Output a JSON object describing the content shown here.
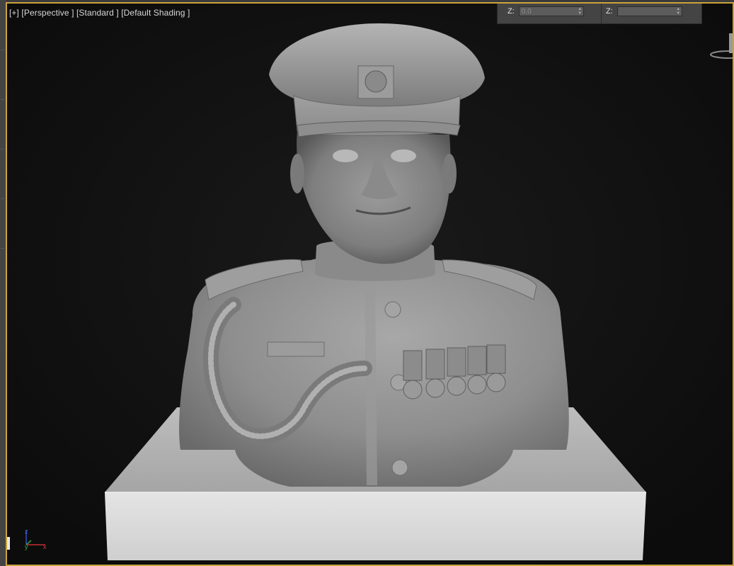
{
  "viewport": {
    "menu_plus": "[+]",
    "view_type": "[Perspective ]",
    "render_style": "[Standard ]",
    "shading_mode": "[Default Shading ]"
  },
  "coords": {
    "z1_label": "Z:",
    "z1_value": "0.0",
    "z2_label": "Z:",
    "z2_value": ""
  },
  "gizmo": {
    "x_label": "x",
    "y_label": "y",
    "z_label": "z"
  },
  "colors": {
    "viewport_border": "#c9a33c",
    "viewport_bg": "#111111",
    "axis_x": "#c03030",
    "axis_y": "#2ea02e",
    "axis_z": "#3050d0"
  }
}
